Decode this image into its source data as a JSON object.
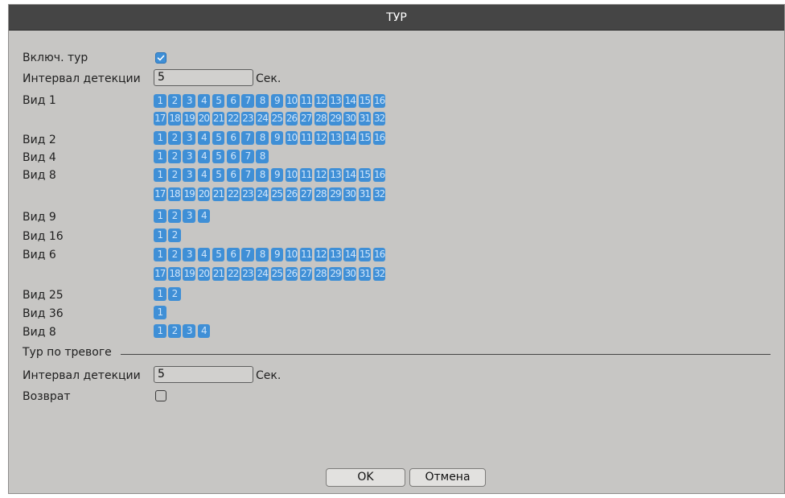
{
  "window": {
    "title": "ТУР"
  },
  "tour_enable": {
    "label": "Включ. тур",
    "checked": true
  },
  "detect_interval": {
    "label": "Интервал детекции",
    "value": "5",
    "unit": "Сек."
  },
  "views": [
    {
      "label": "Вид 1",
      "rows": [
        [
          "1",
          "2",
          "3",
          "4",
          "5",
          "6",
          "7",
          "8",
          "9",
          "10",
          "11",
          "12",
          "13",
          "14",
          "15",
          "16"
        ],
        [
          "17",
          "18",
          "19",
          "20",
          "21",
          "22",
          "23",
          "24",
          "25",
          "26",
          "27",
          "28",
          "29",
          "30",
          "31",
          "32"
        ]
      ]
    },
    {
      "label": "Вид 2",
      "rows": [
        [
          "1",
          "2",
          "3",
          "4",
          "5",
          "6",
          "7",
          "8",
          "9",
          "10",
          "11",
          "12",
          "13",
          "14",
          "15",
          "16"
        ]
      ]
    },
    {
      "label": "Вид 4",
      "rows": [
        [
          "1",
          "2",
          "3",
          "4",
          "5",
          "6",
          "7",
          "8"
        ]
      ]
    },
    {
      "label": "Вид 8",
      "rows": [
        [
          "1",
          "2",
          "3",
          "4",
          "5",
          "6",
          "7",
          "8",
          "9",
          "10",
          "11",
          "12",
          "13",
          "14",
          "15",
          "16"
        ],
        [
          "17",
          "18",
          "19",
          "20",
          "21",
          "22",
          "23",
          "24",
          "25",
          "26",
          "27",
          "28",
          "29",
          "30",
          "31",
          "32"
        ]
      ]
    },
    {
      "label": "Вид 9",
      "rows": [
        [
          "1",
          "2",
          "3",
          "4"
        ]
      ]
    },
    {
      "label": "Вид 16",
      "rows": [
        [
          "1",
          "2"
        ]
      ]
    },
    {
      "label": "Вид 6",
      "rows": [
        [
          "1",
          "2",
          "3",
          "4",
          "5",
          "6",
          "7",
          "8",
          "9",
          "10",
          "11",
          "12",
          "13",
          "14",
          "15",
          "16"
        ],
        [
          "17",
          "18",
          "19",
          "20",
          "21",
          "22",
          "23",
          "24",
          "25",
          "26",
          "27",
          "28",
          "29",
          "30",
          "31",
          "32"
        ]
      ]
    },
    {
      "label": "Вид 25",
      "rows": [
        [
          "1",
          "2"
        ]
      ]
    },
    {
      "label": "Вид 36",
      "rows": [
        [
          "1"
        ]
      ]
    },
    {
      "label": "Вид 8",
      "rows": [
        [
          "1",
          "2",
          "3",
          "4"
        ]
      ]
    }
  ],
  "alarm_tour": {
    "section_label": "Тур по тревоге",
    "interval_label": "Интервал детекции",
    "interval_value": "5",
    "interval_unit": "Сек.",
    "return_label": "Возврат",
    "return_checked": false
  },
  "buttons": {
    "ok": "OK",
    "cancel": "Отмена"
  },
  "colors": {
    "accent": "#3f8fd6",
    "titlebar": "#454545",
    "panel": "#c7c6c4"
  }
}
